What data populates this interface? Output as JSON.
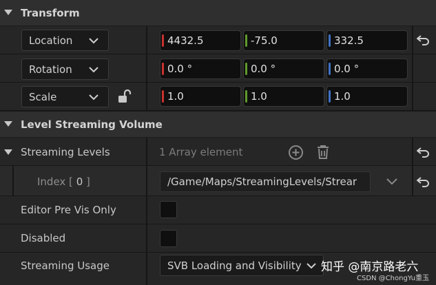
{
  "transform": {
    "title": "Transform",
    "location": {
      "mode": "Location",
      "x": "4432.5",
      "y": "-75.0",
      "z": "332.5"
    },
    "rotation": {
      "mode": "Rotation",
      "x": "0.0 °",
      "y": "0.0 °",
      "z": "0.0 °"
    },
    "scale": {
      "mode": "Scale",
      "x": "1.0",
      "y": "1.0",
      "z": "1.0"
    }
  },
  "level_streaming_volume": {
    "title": "Level Streaming Volume",
    "streaming_levels": {
      "label": "Streaming Levels",
      "count_text": "1 Array element"
    },
    "index_row": {
      "label_prefix": "Index [ ",
      "index": "0",
      "label_suffix": " ]",
      "value": "/Game/Maps/StreamingLevels/Strear"
    },
    "editor_pre_vis_only": {
      "label": "Editor Pre Vis Only",
      "checked": false
    },
    "disabled": {
      "label": "Disabled",
      "checked": false
    },
    "streaming_usage": {
      "label": "Streaming Usage",
      "value": "SVB Loading and Visibility"
    }
  },
  "watermark": {
    "text": "知乎 @南京路老六",
    "sub": "CSDN @ChongYu重玉"
  },
  "colors": {
    "x_axis": "#c8332e",
    "y_axis": "#5f9a2b",
    "z_axis": "#3f72c4"
  }
}
